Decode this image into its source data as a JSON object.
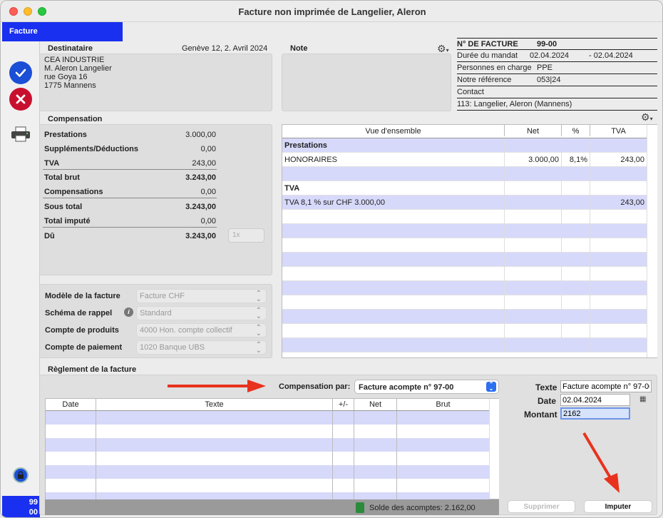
{
  "window": {
    "title": "Facture non imprimée  de Langelier, Aleron"
  },
  "tab": {
    "label": "Facture"
  },
  "destinataire": {
    "header": "Destinataire",
    "date": "Genève 12, 2. Avril 2024",
    "lines": [
      "CEA INDUSTRIE",
      "M. Aleron Langelier",
      "rue Goya 16",
      "1775 Mannens"
    ]
  },
  "note": {
    "header": "Note"
  },
  "info": {
    "rows": [
      {
        "label": "N° DE FACTURE",
        "value": "99-00"
      },
      {
        "label": "Durée du mandat",
        "value": "02.04.2024",
        "value2": "- 02.04.2024"
      },
      {
        "label": "Personnes en charge",
        "value": "PPE"
      },
      {
        "label": "Notre référence",
        "value": "053|24"
      },
      {
        "label": "Contact",
        "value": ""
      },
      {
        "label": "113: Langelier, Aleron (Mannens)",
        "value": ""
      }
    ]
  },
  "compensation": {
    "header": "Compensation",
    "rows": [
      {
        "label": "Prestations",
        "value": "3.000,00",
        "bold": false
      },
      {
        "label": "Suppléments/Déductions",
        "value": "0,00",
        "bold": false
      },
      {
        "label": "TVA",
        "value": "243,00",
        "bold": false
      },
      {
        "label": "Total brut",
        "value": "3.243,00",
        "bold": true
      },
      {
        "label": "Compensations",
        "value": "0,00",
        "bold": false
      },
      {
        "label": "Sous total",
        "value": "3.243,00",
        "bold": true
      },
      {
        "label": "Total imputé",
        "value": "0,00",
        "bold": false
      },
      {
        "label": "Dû",
        "value": "3.243,00",
        "bold": true
      }
    ],
    "copies_placeholder": "1x"
  },
  "selects": [
    {
      "label": "Modèle de la facture",
      "value": "Facture CHF"
    },
    {
      "label": "Schéma de rappel",
      "value": "Standard"
    },
    {
      "label": "Compte de produits",
      "value": "4000 Hon. compte collectif"
    },
    {
      "label": "Compte de paiement",
      "value": "1020 Banque UBS"
    }
  ],
  "overview": {
    "headers": [
      "Vue d'ensemble",
      "Net",
      "%",
      "TVA"
    ],
    "rows": [
      {
        "c": [
          "Prestations",
          "",
          "",
          ""
        ],
        "bold": true
      },
      {
        "c": [
          "HONORAIRES",
          "3.000,00",
          "8,1%",
          "243,00"
        ]
      },
      {
        "c": [
          "",
          "",
          "",
          ""
        ]
      },
      {
        "c": [
          "TVA",
          "",
          "",
          ""
        ],
        "bold": true
      },
      {
        "c": [
          "TVA 8,1 % sur CHF 3.000,00",
          "",
          "",
          "243,00"
        ]
      },
      {
        "c": [
          "",
          "",
          "",
          ""
        ]
      },
      {
        "c": [
          "",
          "",
          "",
          ""
        ]
      },
      {
        "c": [
          "",
          "",
          "",
          ""
        ]
      },
      {
        "c": [
          "",
          "",
          "",
          ""
        ]
      },
      {
        "c": [
          "",
          "",
          "",
          ""
        ]
      },
      {
        "c": [
          "",
          "",
          "",
          ""
        ]
      },
      {
        "c": [
          "",
          "",
          "",
          ""
        ]
      },
      {
        "c": [
          "",
          "",
          "",
          ""
        ]
      },
      {
        "c": [
          "",
          "",
          "",
          ""
        ]
      },
      {
        "c": [
          "",
          "",
          "",
          ""
        ]
      }
    ]
  },
  "reglement": {
    "header": "Règlement de la facture",
    "comp_label": "Compensation par:",
    "comp_value": "Facture acompte n° 97-00",
    "headers": [
      "Date",
      "Texte",
      "+/-",
      "Net",
      "Brut"
    ],
    "texte_label": "Texte",
    "texte_value": "Facture acompte n° 97-00",
    "date_label": "Date",
    "date_value": "02.04.2024",
    "montant_label": "Montant",
    "montant_value": "2162",
    "solde": "Solde des acomptes: 2.162,00",
    "supprimer": "Supprimer",
    "imputer": "Imputer"
  },
  "footer": {
    "line1": "99",
    "line2": "00"
  },
  "colors": {
    "accent": "#1930f0",
    "stripe": "#d7d9fa",
    "arrow": "#e8321e"
  }
}
